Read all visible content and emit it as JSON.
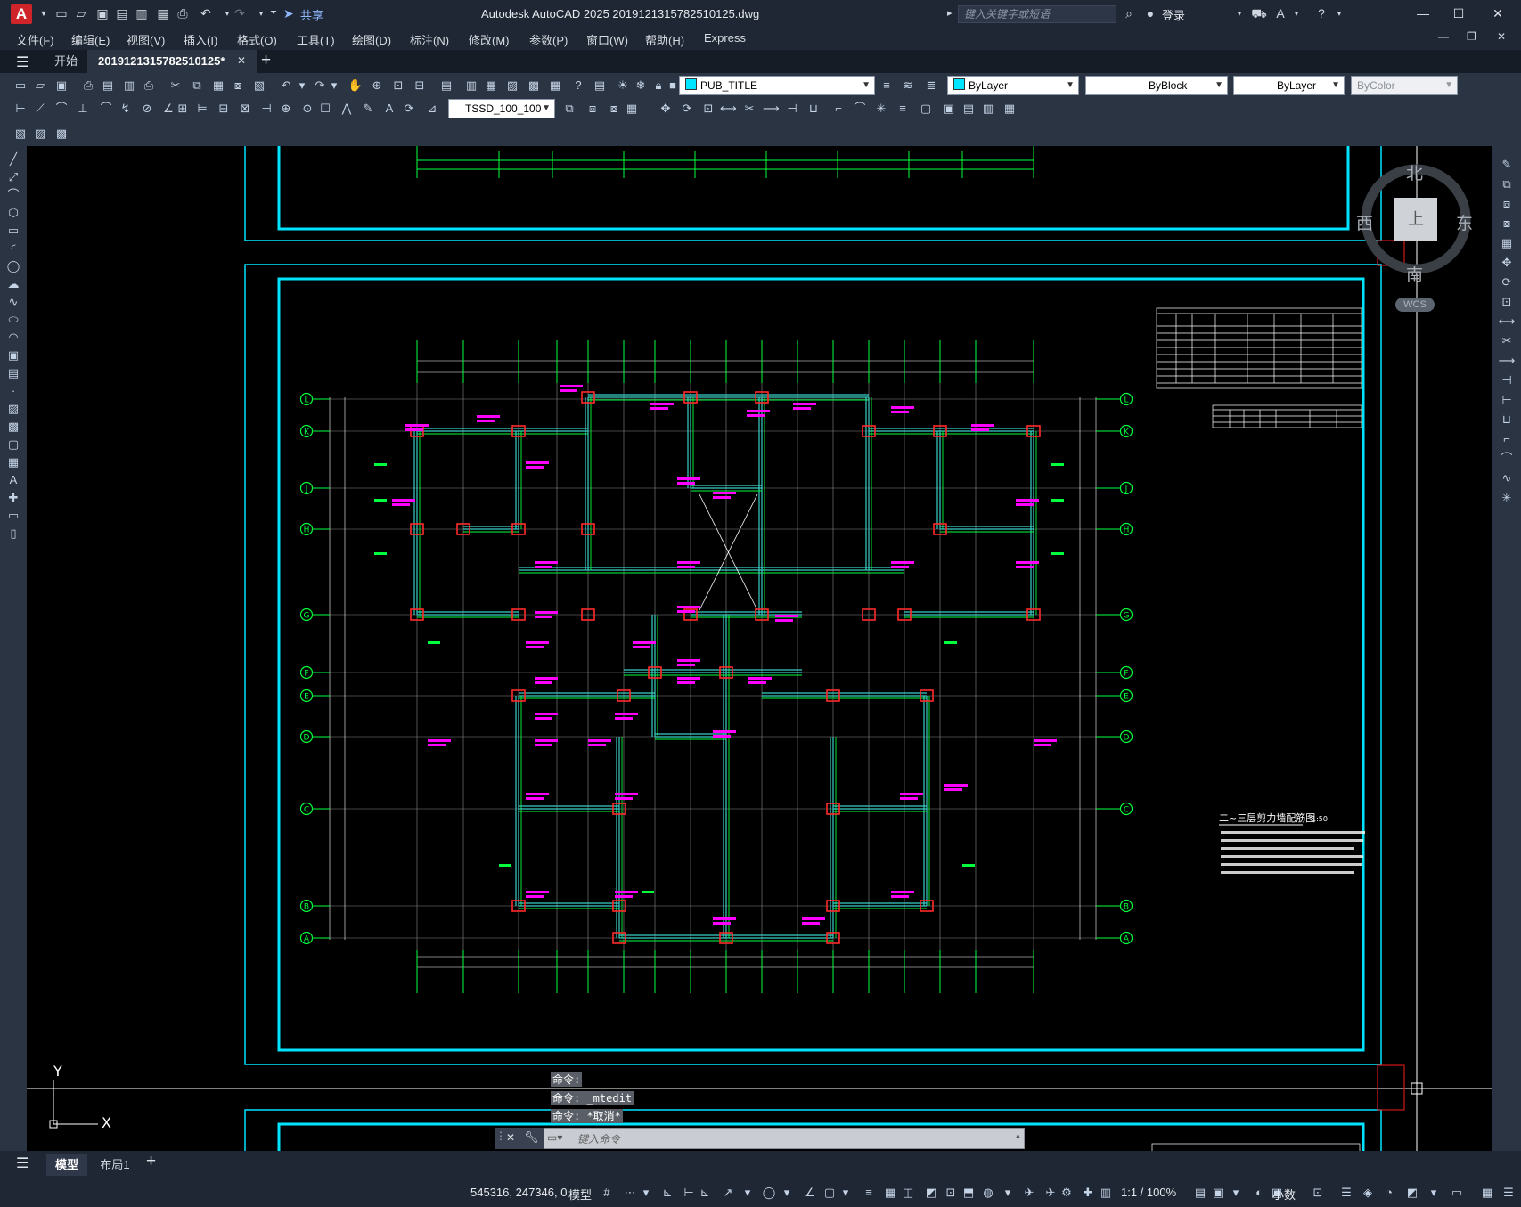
{
  "app": {
    "logo_letter": "A",
    "share_label": "共享",
    "window_title": "Autodesk AutoCAD 2025    20191213157825101​25.dwg",
    "search_placeholder": "键入关键字或短语",
    "login_label": "登录"
  },
  "menu": [
    "文件(F)",
    "编辑(E)",
    "视图(V)",
    "插入(I)",
    "格式(O)",
    "工具(T)",
    "绘图(D)",
    "标注(N)",
    "修改(M)",
    "参数(P)",
    "窗口(W)",
    "帮助(H)",
    "Express"
  ],
  "tabs": {
    "start": "开始",
    "document": "20191213157825101​25*"
  },
  "properties": {
    "layer": "PUB_TITLE",
    "color": "ByLayer",
    "linetype": "ByBlock",
    "lineweight": "ByLayer",
    "plotstyle": "ByColor",
    "dimstyle": "TSSD_100_100"
  },
  "viewcube": {
    "north": "北",
    "south": "南",
    "east": "东",
    "west": "西",
    "face": "上",
    "wcs": "WCS"
  },
  "ucs": {
    "x": "X",
    "y": "Y"
  },
  "drawing": {
    "title": "二~三层剪力墙配筋图",
    "scale": "1:50",
    "axis_left": [
      "L",
      "K",
      "J",
      "H",
      "G",
      "F",
      "E",
      "D",
      "C",
      "B",
      "A"
    ],
    "axis_right": [
      "L",
      "K",
      "J",
      "H",
      "G",
      "F",
      "E",
      "D",
      "C",
      "B",
      "A"
    ]
  },
  "command": {
    "history": [
      "命令:",
      "命令: _mtedit",
      "命令: *取消*"
    ],
    "input_placeholder": "键入命令"
  },
  "layout_tabs": {
    "model": "模型",
    "layout1": "布局1"
  },
  "status": {
    "coords": "545316, 247346, 0",
    "model": "模型",
    "scale": "1:1 / 100%",
    "units": "小数"
  },
  "colors": {
    "accent_cyan": "#00e5ff",
    "drawing_green": "#00ff3c",
    "wall_cyan": "#3ad0c8",
    "annotation_magenta": "#ff00ff",
    "red": "#ff2a2a"
  }
}
